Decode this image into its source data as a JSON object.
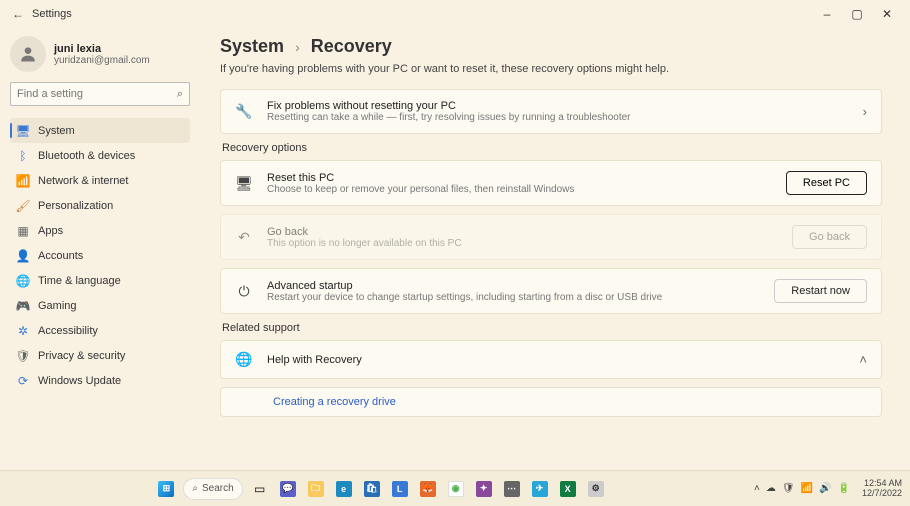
{
  "titlebar": {
    "back_icon": "←",
    "title": "Settings",
    "min": "–",
    "max": "▢",
    "close": "✕"
  },
  "user": {
    "name": "juni lexia",
    "email": "yuridzani@gmail.com"
  },
  "search": {
    "placeholder": "Find a setting",
    "icon": "⌕"
  },
  "nav": [
    {
      "icon": "🖥",
      "label": "System",
      "color": "#3a78d6",
      "active": true
    },
    {
      "icon": "ᛒ",
      "label": "Bluetooth & devices",
      "color": "#3a78d6"
    },
    {
      "icon": "📶",
      "label": "Network & internet",
      "color": "#3a78d6"
    },
    {
      "icon": "🖌",
      "label": "Personalization",
      "color": "#c97a35"
    },
    {
      "icon": "▦",
      "label": "Apps",
      "color": "#666"
    },
    {
      "icon": "👤",
      "label": "Accounts",
      "color": "#d68a3a"
    },
    {
      "icon": "🌐",
      "label": "Time & language",
      "color": "#3a78d6"
    },
    {
      "icon": "🎮",
      "label": "Gaming",
      "color": "#666"
    },
    {
      "icon": "✲",
      "label": "Accessibility",
      "color": "#3a78d6"
    },
    {
      "icon": "🛡",
      "label": "Privacy & security",
      "color": "#666"
    },
    {
      "icon": "⟳",
      "label": "Windows Update",
      "color": "#3a78d6"
    }
  ],
  "breadcrumb": {
    "parent": "System",
    "sep": "›",
    "current": "Recovery"
  },
  "subtitle": "If you're having problems with your PC or want to reset it, these recovery options might help.",
  "fix_card": {
    "title": "Fix problems without resetting your PC",
    "desc": "Resetting can take a while — first, try resolving issues by running a troubleshooter",
    "chev": "›"
  },
  "recovery_label": "Recovery options",
  "reset_card": {
    "title": "Reset this PC",
    "desc": "Choose to keep or remove your personal files, then reinstall Windows",
    "button": "Reset PC"
  },
  "goback_card": {
    "title": "Go back",
    "desc": "This option is no longer available on this PC",
    "button": "Go back"
  },
  "advanced_card": {
    "title": "Advanced startup",
    "desc": "Restart your device to change startup settings, including starting from a disc or USB drive",
    "button": "Restart now"
  },
  "related_label": "Related support",
  "help_card": {
    "title": "Help with Recovery",
    "chev": "˄"
  },
  "link1": "Creating a recovery drive",
  "taskbar": {
    "search": "Search",
    "tray_chevron": "˄",
    "clock_time": "12:54 AM",
    "clock_date": "12/7/2022"
  }
}
